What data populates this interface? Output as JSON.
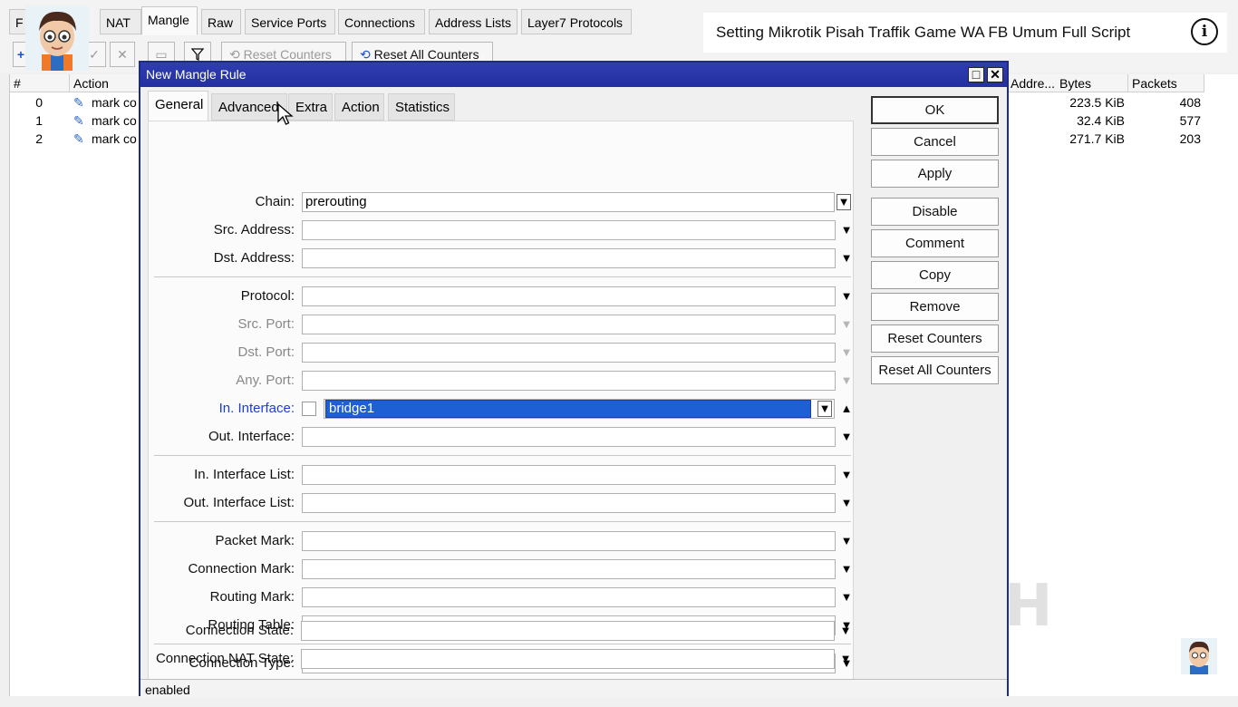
{
  "video": {
    "title": "Setting Mikrotik Pisah Traffik Game WA FB Umum Full Script",
    "info_icon": "info-icon",
    "watermark": "TEGUH PWD"
  },
  "main_window": {
    "tabs": [
      "F",
      "NAT",
      "Mangle",
      "Raw",
      "Service Ports",
      "Connections",
      "Address Lists",
      "Layer7 Protocols"
    ],
    "active_tab": "Mangle",
    "toolbar": {
      "reset_counters": "Reset Counters",
      "reset_all_counters": "Reset All Counters"
    },
    "table": {
      "headers": {
        "num": "#",
        "action": "Action",
        "address": "Addre...",
        "bytes": "Bytes",
        "packets": "Packets"
      },
      "rows": [
        {
          "num": "0",
          "action": "mark co",
          "bytes": "223.5 KiB",
          "packets": "408"
        },
        {
          "num": "1",
          "action": "mark co",
          "bytes": "32.4 KiB",
          "packets": "577"
        },
        {
          "num": "2",
          "action": "mark co",
          "bytes": "271.7 KiB",
          "packets": "203"
        }
      ]
    }
  },
  "dialog": {
    "title": "New Mangle Rule",
    "tabs": [
      "General",
      "Advanced",
      "Extra",
      "Action",
      "Statistics"
    ],
    "active_tab": "General",
    "fields": {
      "chain": {
        "label": "Chain:",
        "value": "prerouting"
      },
      "src_address": {
        "label": "Src. Address:",
        "value": ""
      },
      "dst_address": {
        "label": "Dst. Address:",
        "value": ""
      },
      "protocol": {
        "label": "Protocol:",
        "value": ""
      },
      "src_port": {
        "label": "Src. Port:",
        "value": ""
      },
      "dst_port": {
        "label": "Dst. Port:",
        "value": ""
      },
      "any_port": {
        "label": "Any. Port:",
        "value": ""
      },
      "in_interface": {
        "label": "In. Interface:",
        "value": "bridge1"
      },
      "out_interface": {
        "label": "Out. Interface:",
        "value": ""
      },
      "in_interface_list": {
        "label": "In. Interface List:",
        "value": ""
      },
      "out_interface_list": {
        "label": "Out. Interface List:",
        "value": ""
      },
      "packet_mark": {
        "label": "Packet Mark:",
        "value": ""
      },
      "connection_mark": {
        "label": "Connection Mark:",
        "value": ""
      },
      "routing_mark": {
        "label": "Routing Mark:",
        "value": ""
      },
      "routing_table": {
        "label": "Routing Table:",
        "value": ""
      },
      "connection_type": {
        "label": "Connection Type:",
        "value": ""
      },
      "connection_state": {
        "label": "Connection State:",
        "value": ""
      },
      "connection_nat_state": {
        "label": "Connection NAT State:",
        "value": ""
      }
    },
    "buttons": {
      "ok": "OK",
      "cancel": "Cancel",
      "apply": "Apply",
      "disable": "Disable",
      "comment": "Comment",
      "copy": "Copy",
      "remove": "Remove",
      "reset_counters": "Reset Counters",
      "reset_all_counters": "Reset All Counters"
    },
    "status": "enabled"
  },
  "colors": {
    "titlebar": "#2430a0",
    "selection": "#1f5fd6",
    "link_label": "#1b3ed0"
  }
}
